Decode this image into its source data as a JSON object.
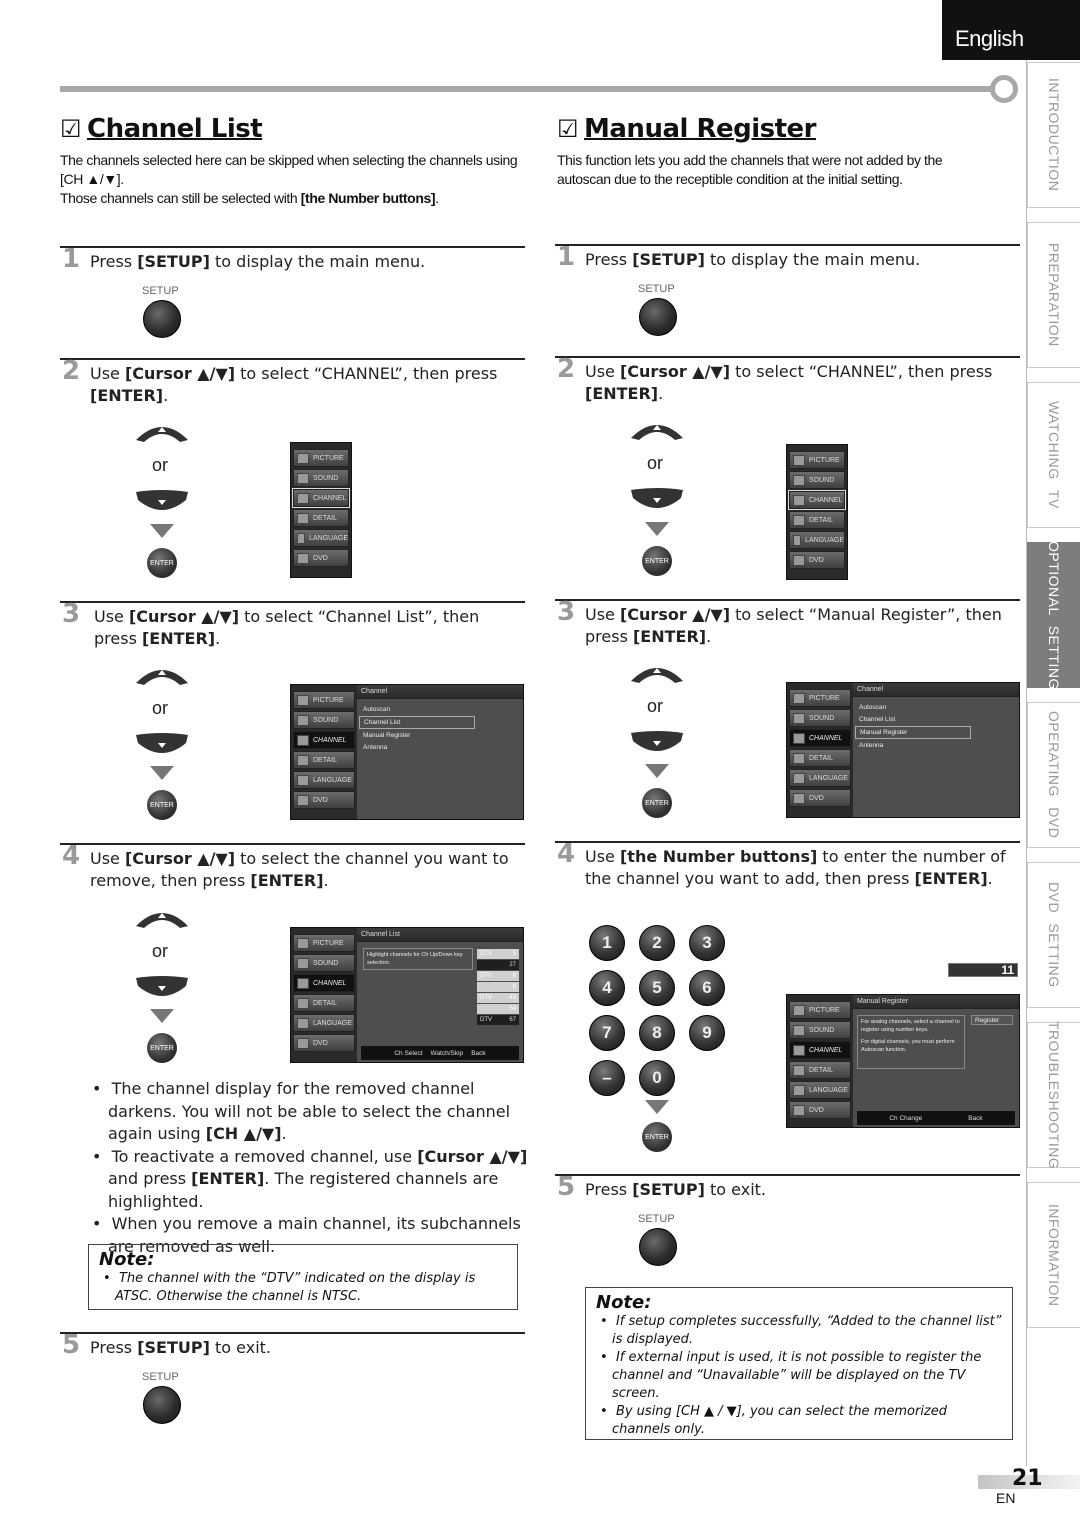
{
  "header": {
    "language_tab": "English"
  },
  "side_tabs": [
    {
      "label": "INTRODUCTION",
      "active": false
    },
    {
      "label": "PREPARATION",
      "active": false
    },
    {
      "label": "WATCHING  TV",
      "active": false
    },
    {
      "label": "OPTIONAL  SETTING",
      "active": true
    },
    {
      "label": "OPERATING  DVD",
      "active": false
    },
    {
      "label": "DVD  SETTING",
      "active": false
    },
    {
      "label": "TROUBLESHOOTING",
      "active": false
    },
    {
      "label": "INFORMATION",
      "active": false
    }
  ],
  "checkbox_glyph": "☑",
  "icons": {
    "up": "▲",
    "down": "▼",
    "bullet": "•"
  },
  "remote": {
    "setup_label": "SETUP",
    "enter_label": "ENTER",
    "or_label": "or",
    "keypad": [
      "1",
      "2",
      "3",
      "4",
      "5",
      "6",
      "7",
      "8",
      "9",
      "–",
      "0"
    ]
  },
  "tv_menu": {
    "sidebar": [
      "PICTURE",
      "SOUND",
      "CHANNEL",
      "DETAIL",
      "LANGUAGE",
      "DVD"
    ],
    "channel_header": "Channel",
    "channel_options": [
      "Autoscan",
      "Channel List",
      "Manual Register",
      "Antenna"
    ],
    "channel_list": {
      "header": "Channel List",
      "hint": "Highlight channels for Ch Up/Down key selection.",
      "channels": [
        {
          "type": "DTV",
          "num": "5",
          "state": "on"
        },
        {
          "type": "",
          "num": "27",
          "state": "off"
        },
        {
          "type": "DTV",
          "num": "8",
          "state": "on"
        },
        {
          "type": "",
          "num": "8",
          "state": "on"
        },
        {
          "type": "DTV",
          "num": "43",
          "state": "on"
        },
        {
          "type": "",
          "num": "54",
          "state": "on"
        },
        {
          "type": "DTV",
          "num": "67",
          "state": "off"
        }
      ],
      "footer": [
        "Ch Select",
        "Watch/Skip",
        "Back"
      ]
    },
    "manual_register": {
      "channel_display": "11",
      "header": "Manual Register",
      "hint_analog": "For analog channels, select a channel to register using number keys.",
      "hint_digital": "For digital channels, you must perform Autoscan function.",
      "register_button": "Register",
      "footer": [
        "Ch Change",
        "Back"
      ]
    }
  },
  "channel_list": {
    "title": "Channel List",
    "intro_1": "The channels selected here can be skipped when selecting the channels using [CH ▲/▼].",
    "intro_2_pre": "Those channels can still be selected with ",
    "intro_2_bold": "[the Number buttons]",
    "intro_2_post": ".",
    "steps": [
      {
        "num": "1",
        "pre": "Press ",
        "bold": "[SETUP]",
        "post": " to display the main menu."
      },
      {
        "num": "2",
        "pre": "Use ",
        "bold": "[Cursor ▲/▼]",
        "post": " to select “CHANNEL”, then press ",
        "bold2": "[ENTER]",
        "post2": "."
      },
      {
        "num": "3",
        "pre": "Use ",
        "bold": "[Cursor ▲/▼]",
        "post": " to select “Channel List”, then press ",
        "bold2": "[ENTER]",
        "post2": "."
      },
      {
        "num": "4",
        "pre": "Use ",
        "bold": "[Cursor ▲/▼]",
        "post": " to select the channel you want to remove, then press ",
        "bold2": "[ENTER]",
        "post2": "."
      },
      {
        "num": "5",
        "pre": "Press ",
        "bold": "[SETUP]",
        "post": " to exit."
      }
    ],
    "bullets": [
      {
        "pre": "The channel display for the removed channel darkens. You will not be able to select the channel again using ",
        "bold": "[CH ▲/▼]",
        "post": ".",
        "bold2": "",
        "post2": ""
      },
      {
        "pre": "To reactivate a removed channel, use ",
        "bold": "[Cursor ▲/▼]",
        "post": " and press ",
        "bold2": "[ENTER]",
        "post2": ". The registered channels are highlighted."
      },
      {
        "pre": "When you remove a main channel, its subchannels are removed as well.",
        "bold": "",
        "post": "",
        "bold2": "",
        "post2": ""
      }
    ],
    "note": {
      "title": "Note:",
      "items": [
        "The channel with the “DTV” indicated on the display is ATSC. Otherwise the channel is NTSC."
      ]
    }
  },
  "manual_register": {
    "title": "Manual Register",
    "intro": "This function lets you add the channels that were not added by the autoscan due to the receptible condition at the initial setting.",
    "steps": [
      {
        "num": "1",
        "pre": "Press ",
        "bold": "[SETUP]",
        "post": " to display the main menu."
      },
      {
        "num": "2",
        "pre": "Use ",
        "bold": "[Cursor ▲/▼]",
        "post": " to select “CHANNEL”, then press ",
        "bold2": "[ENTER]",
        "post2": "."
      },
      {
        "num": "3",
        "pre": "Use ",
        "bold": "[Cursor ▲/▼]",
        "post": " to select “Manual Register”, then press ",
        "bold2": "[ENTER]",
        "post2": "."
      },
      {
        "num": "4",
        "pre": "Use ",
        "bold": "[the Number buttons]",
        "post": " to enter the number of the channel you want to add, then press ",
        "bold2": "[ENTER]",
        "post2": "."
      },
      {
        "num": "5",
        "pre": "Press ",
        "bold": "[SETUP]",
        "post": " to exit."
      }
    ],
    "note": {
      "title": "Note:",
      "items": [
        "If setup completes successfully, “Added to the channel list” is displayed.",
        "If external input is used, it is not possible to register the channel and “Unavailable” will be displayed on the TV screen.",
        "By using [CH ▲ / ▼], you can select the memorized channels only."
      ]
    }
  },
  "footer": {
    "page_number": "21",
    "lang_code": "EN"
  }
}
